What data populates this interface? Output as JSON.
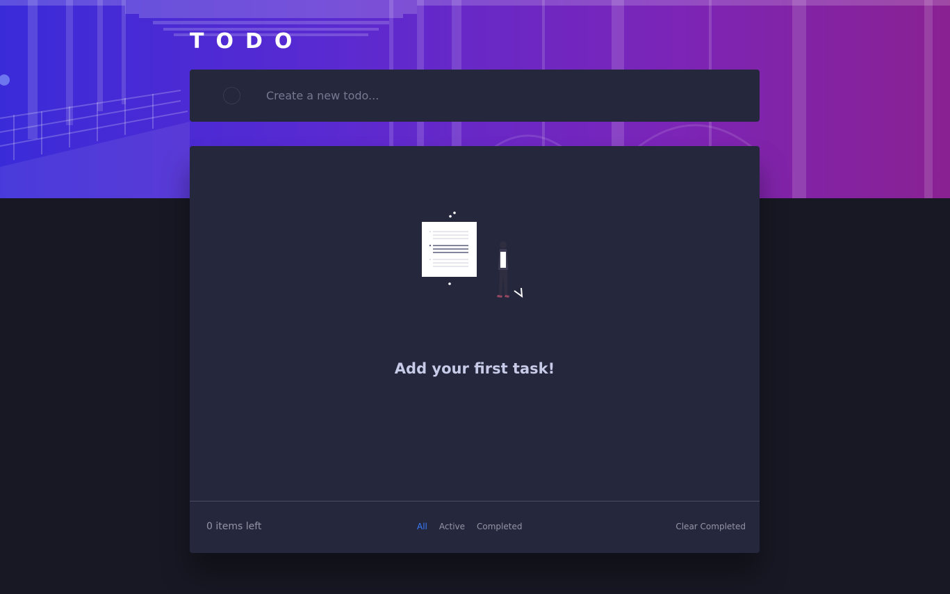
{
  "app": {
    "title": "TODO"
  },
  "create": {
    "placeholder": "Create a new todo...",
    "value": ""
  },
  "list": {
    "empty_message": "Add your first task!",
    "items": []
  },
  "footer": {
    "items_left": "0 items left",
    "filters": [
      {
        "label": "All",
        "active": true
      },
      {
        "label": "Active",
        "active": false
      },
      {
        "label": "Completed",
        "active": false
      }
    ],
    "clear_completed": "Clear Completed"
  },
  "colors": {
    "accent": "#3a7cfd",
    "card": "#25273c",
    "background": "#181824",
    "gradient_start": "#3a2bd8",
    "gradient_end": "#8a2192"
  },
  "icons": {
    "check_circle": "check-circle-icon",
    "empty_illustration": "empty-list-illustration"
  }
}
